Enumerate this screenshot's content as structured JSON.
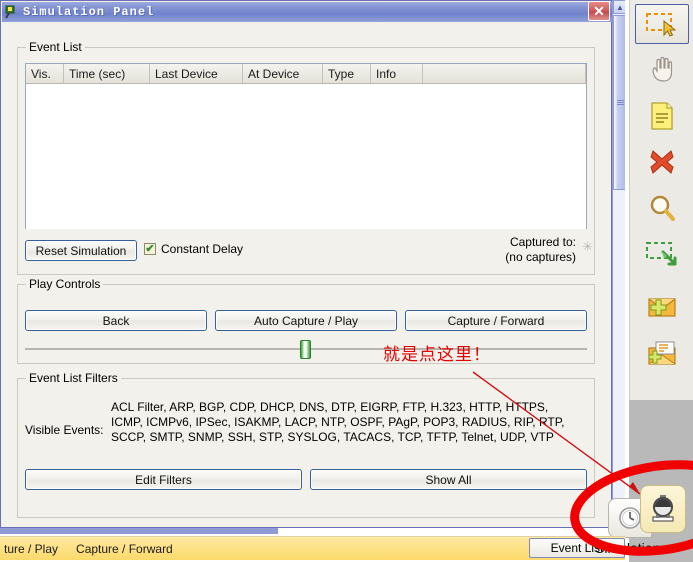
{
  "window": {
    "title": "Simulation Panel",
    "title_icon": "simulation-panel-icon",
    "close_label": "✕"
  },
  "event_list": {
    "legend": "Event List",
    "columns": [
      "Vis.",
      "Time (sec)",
      "Last Device",
      "At Device",
      "Type",
      "Info"
    ],
    "rows": []
  },
  "controls": {
    "reset_label": "Reset Simulation",
    "constant_delay_label": "Constant Delay",
    "constant_delay_checked": true,
    "check_glyph": "✔",
    "captured_to_label": "Captured to:",
    "captured_to_value": "(no captures)",
    "captured_icon": "✳"
  },
  "play_controls": {
    "legend": "Play Controls",
    "back_label": "Back",
    "auto_label": "Auto Capture / Play",
    "forward_label": "Capture / Forward",
    "slider_position_pct": 50
  },
  "filters": {
    "legend": "Event List Filters",
    "visible_events_label": "Visible Events:",
    "visible_events": "ACL Filter, ARP, BGP, CDP, DHCP, DNS, DTP, EIGRP, FTP, H.323, HTTP, HTTPS, ICMP, ICMPv6, IPSec, ISAKMP, LACP, NTP, OSPF, PAgP, POP3, RADIUS, RIP, RTP, SCCP, SMTP, SNMP, SSH, STP, SYSLOG, TACACS, TCP, TFTP, Telnet, UDP, VTP",
    "edit_filters_label": "Edit Filters",
    "show_all_label": "Show All"
  },
  "toolbar": {
    "tools": [
      {
        "name": "select-tool",
        "selected": true
      },
      {
        "name": "hand-pan-tool",
        "selected": false
      },
      {
        "name": "place-note-tool",
        "selected": false
      },
      {
        "name": "delete-tool",
        "selected": false
      },
      {
        "name": "inspect-magnifier-tool",
        "selected": false
      },
      {
        "name": "resize-shape-tool",
        "selected": false
      },
      {
        "name": "add-simple-pdu-tool",
        "selected": false
      },
      {
        "name": "add-complex-pdu-tool",
        "selected": false
      }
    ]
  },
  "mode_toggle": {
    "realtime_icon": "clock-icon",
    "simulation_icon": "stopwatch-simulation-icon",
    "active": "simulation"
  },
  "status_bar": {
    "left_text_1": "ture / Play",
    "left_text_2": "Capture / Forward",
    "event_list_button": "Event List",
    "mode_label": "Simulation"
  },
  "annotations": {
    "note_text": "就是点这里！",
    "note_color": "#e60000",
    "arrow_color": "#cc1111",
    "ellipse_color": "#f00000"
  },
  "scrollbar": {
    "up_glyph": "▲",
    "down_glyph": "▼"
  }
}
